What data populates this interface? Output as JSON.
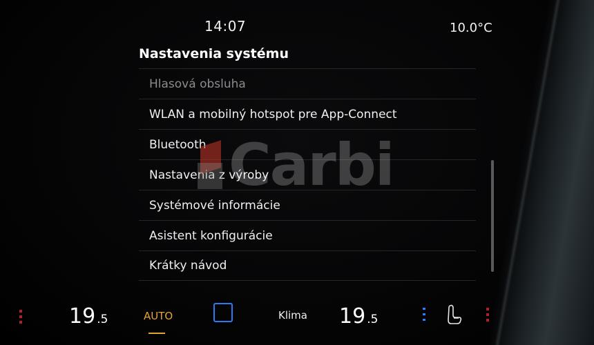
{
  "status": {
    "time": "14:07",
    "outside_temp": "10.0°C"
  },
  "page": {
    "title": "Nastavenia systému",
    "items": [
      {
        "label": "Hlasová obsluha"
      },
      {
        "label": "WLAN a mobilný hotspot pre App-Connect"
      },
      {
        "label": "Bluetooth"
      },
      {
        "label": "Nastavenia z výroby"
      },
      {
        "label": "Systémové informácie"
      },
      {
        "label": "Asistent konfigurácie"
      },
      {
        "label": "Krátky návod"
      }
    ]
  },
  "watermark": {
    "text": "Carbi"
  },
  "climate": {
    "left_temp_int": "19",
    "left_temp_dec": ".5",
    "auto_label": "AUTO",
    "klima_label": "Klima",
    "right_temp_int": "19",
    "right_temp_dec": ".5"
  },
  "colors": {
    "auto": "#e5a531",
    "sync": "#2a7df0",
    "seat_heat": "#b0202a",
    "vent": "#2f7dff"
  },
  "icons": [
    "sync-square-icon",
    "seat-icon",
    "seat-heat-indicator",
    "seat-ventilation-indicator"
  ]
}
